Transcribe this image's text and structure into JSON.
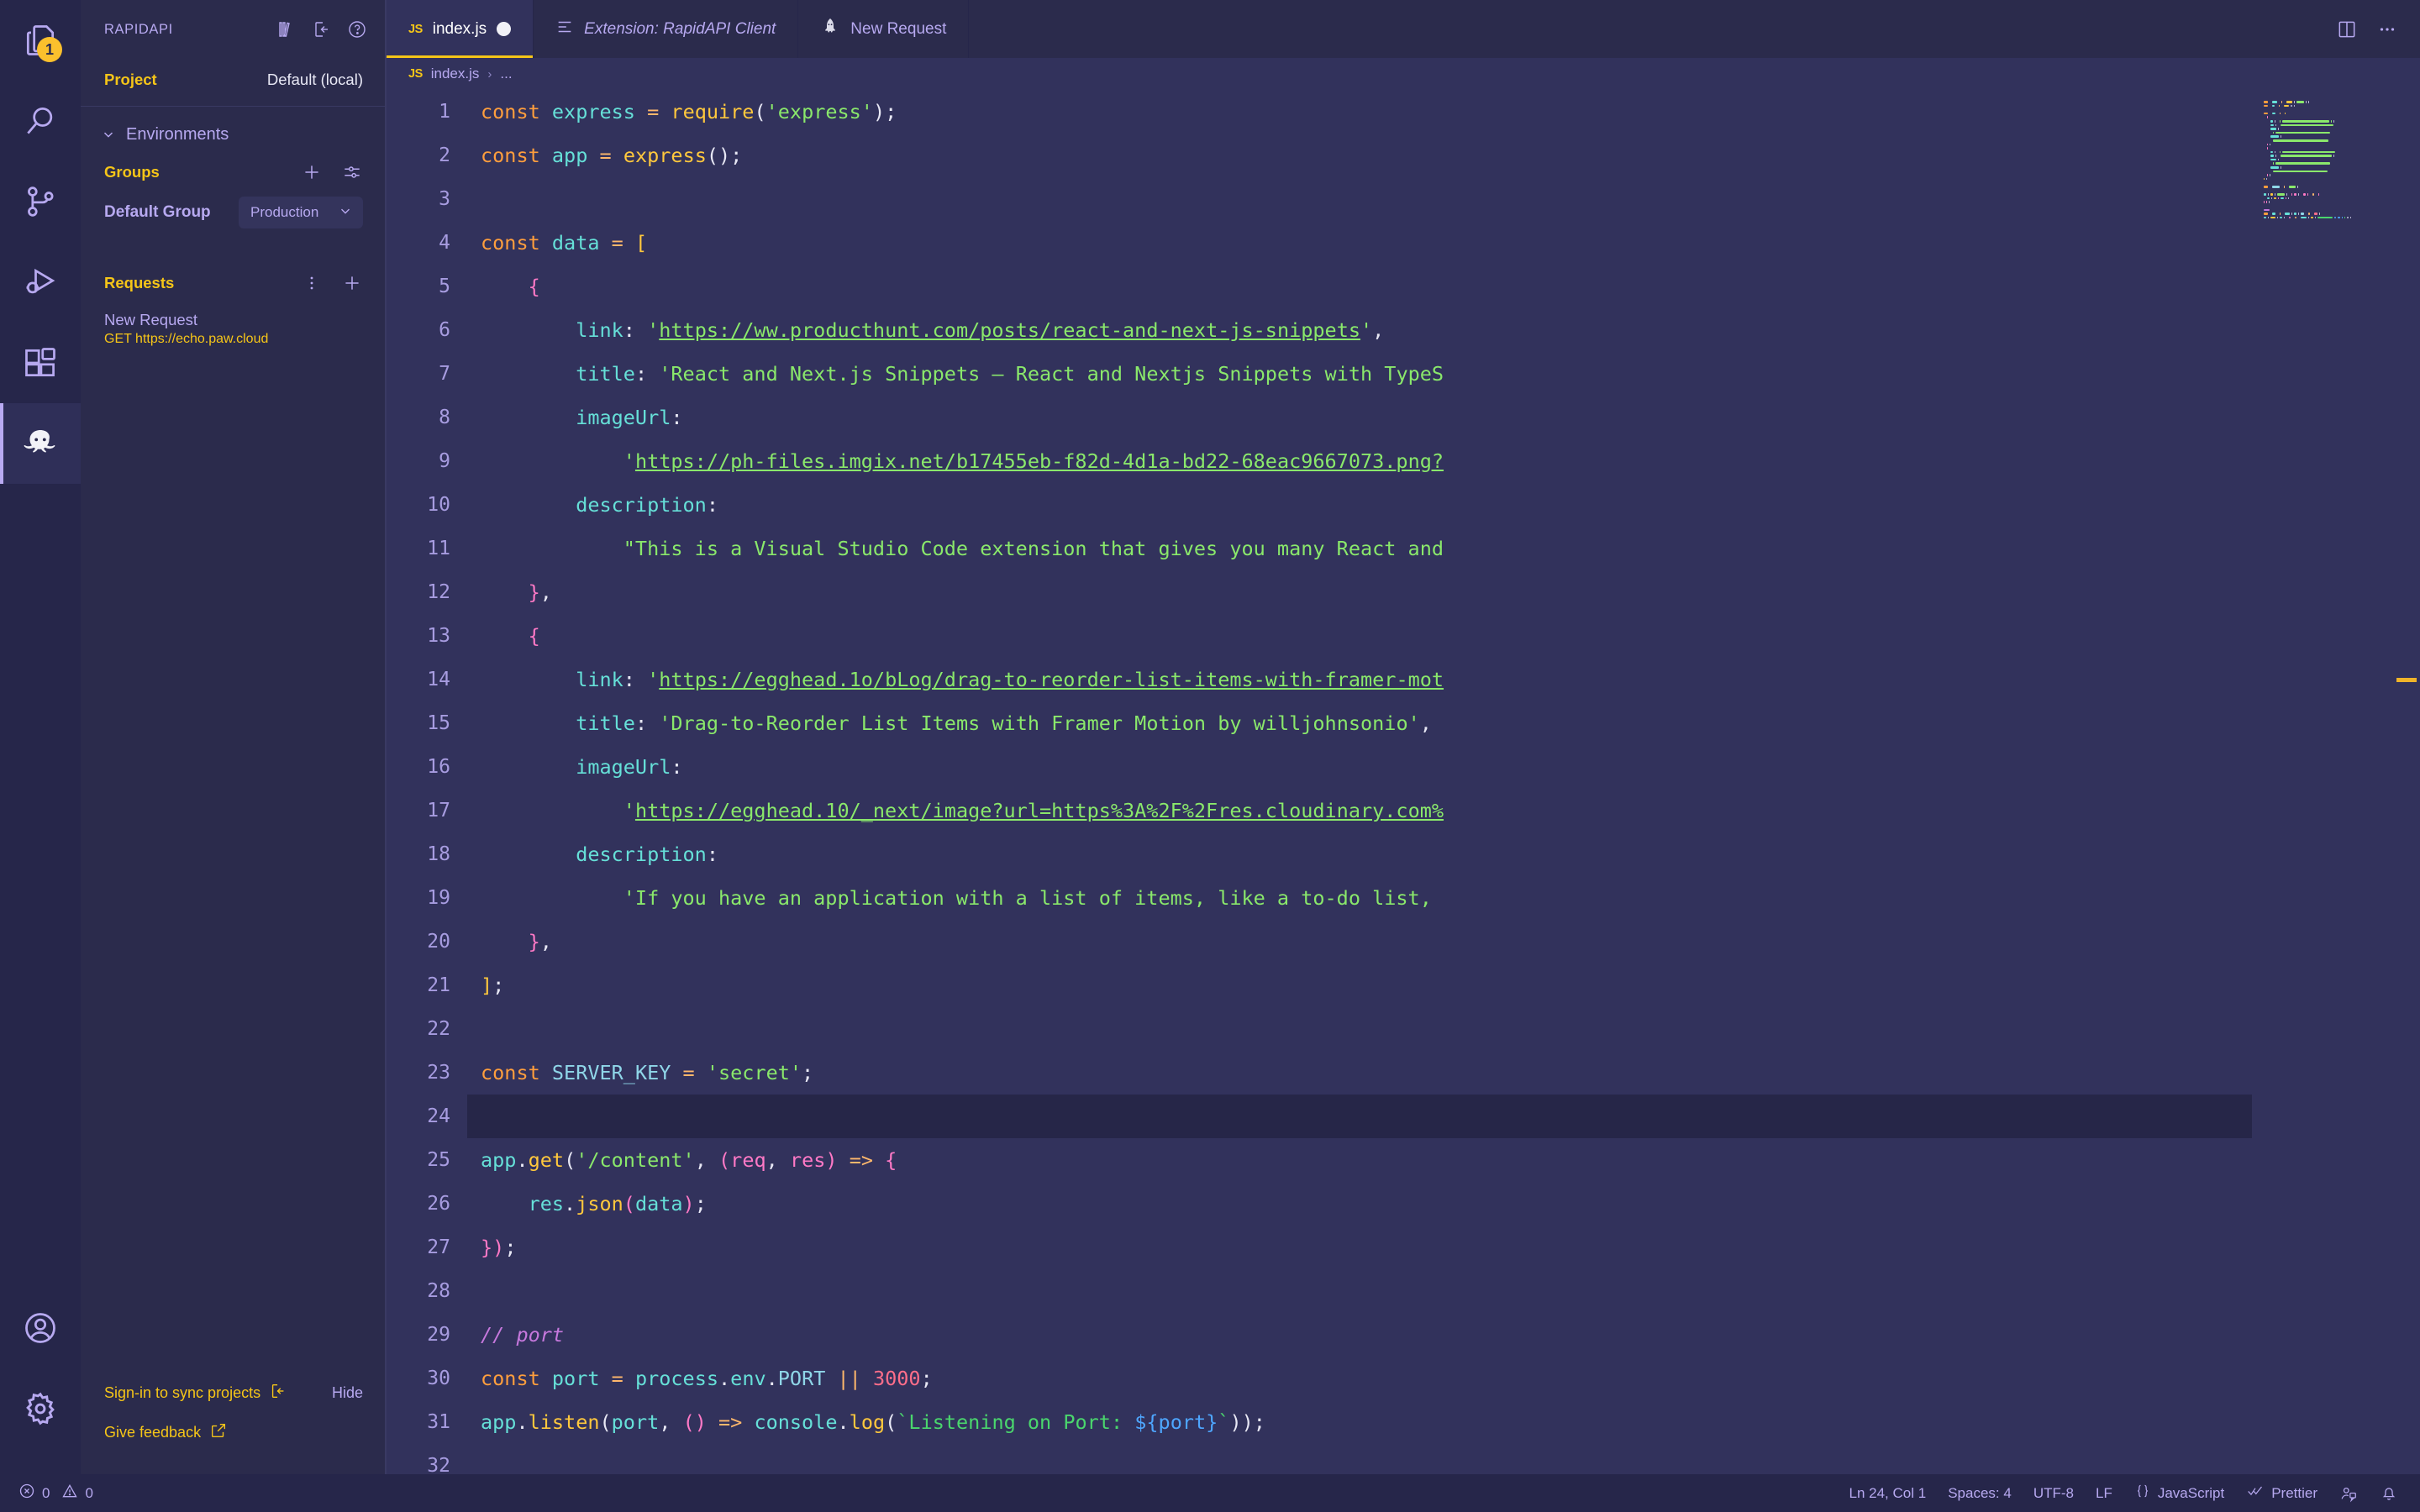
{
  "activity_bar": {
    "items": [
      {
        "name": "explorer",
        "icon": "files-icon",
        "badge": "1",
        "active": false
      },
      {
        "name": "search",
        "icon": "search-icon",
        "badge": "",
        "active": false
      },
      {
        "name": "source-control",
        "icon": "source-control-icon",
        "badge": "",
        "active": false
      },
      {
        "name": "run-debug",
        "icon": "run-debug-icon",
        "badge": "",
        "active": false
      },
      {
        "name": "extensions",
        "icon": "extensions-icon",
        "badge": "",
        "active": false
      },
      {
        "name": "rapidapi",
        "icon": "rapidapi-octopus-icon",
        "badge": "",
        "active": true
      }
    ],
    "bottom_items": [
      {
        "name": "accounts",
        "icon": "account-icon"
      },
      {
        "name": "manage",
        "icon": "gear-icon"
      }
    ]
  },
  "sidebar": {
    "title": "RAPIDAPI",
    "header_icons": [
      "library-icon",
      "open-panel-icon",
      "help-icon"
    ],
    "project": {
      "label": "Project",
      "value": "Default (local)"
    },
    "environments": {
      "label": "Environments",
      "collapse_icon": "chevron-down-icon"
    },
    "groups": {
      "label": "Groups",
      "add_icon": "plus-icon",
      "settings_icon": "sliders-icon",
      "rows": [
        {
          "name": "Default Group",
          "environment": "Production",
          "chevron": "chevron-down-icon"
        }
      ]
    },
    "requests": {
      "label": "Requests",
      "more_icon": "kebab-icon",
      "add_icon": "plus-icon",
      "items": [
        {
          "name": "New Request",
          "method_url": "GET https://echo.paw.cloud"
        }
      ]
    },
    "footer": {
      "signin_label": "Sign-in to sync projects",
      "signin_icon": "sign-in-icon",
      "hide_label": "Hide",
      "feedback_label": "Give feedback",
      "feedback_icon": "external-link-icon"
    }
  },
  "tabs": [
    {
      "label": "index.js",
      "icon": "js-file-icon",
      "active": true,
      "dirty": true,
      "italic": false
    },
    {
      "label": "Extension: RapidAPI Client",
      "icon": "extension-icon",
      "active": false,
      "dirty": false,
      "italic": true
    },
    {
      "label": "New Request",
      "icon": "rocket-icon",
      "active": false,
      "dirty": false,
      "italic": false
    }
  ],
  "tabbar_actions": [
    {
      "name": "split-editor",
      "icon": "split-editor-icon"
    },
    {
      "name": "more-actions",
      "icon": "ellipsis-icon"
    }
  ],
  "breadcrumb": {
    "file_icon": "js-file-icon",
    "file": "index.js",
    "separator": "›",
    "rest": "..."
  },
  "editor": {
    "first_line": 1,
    "cursor_line": 24,
    "lines": [
      {
        "n": 1,
        "tokens": [
          [
            "kw",
            "const"
          ],
          [
            "plain",
            " "
          ],
          [
            "var",
            "express"
          ],
          [
            "plain",
            " "
          ],
          [
            "op",
            "="
          ],
          [
            "plain",
            " "
          ],
          [
            "fn",
            "require"
          ],
          [
            "punc",
            "("
          ],
          [
            "str",
            "'express'"
          ],
          [
            "punc",
            ")"
          ],
          [
            "punc",
            ";"
          ]
        ]
      },
      {
        "n": 2,
        "tokens": [
          [
            "kw",
            "const"
          ],
          [
            "plain",
            " "
          ],
          [
            "var",
            "app"
          ],
          [
            "plain",
            " "
          ],
          [
            "op",
            "="
          ],
          [
            "plain",
            " "
          ],
          [
            "fn",
            "express"
          ],
          [
            "punc",
            "()"
          ],
          [
            "punc",
            ";"
          ]
        ]
      },
      {
        "n": 3,
        "tokens": []
      },
      {
        "n": 4,
        "tokens": [
          [
            "kw",
            "const"
          ],
          [
            "plain",
            " "
          ],
          [
            "var",
            "data"
          ],
          [
            "plain",
            " "
          ],
          [
            "op",
            "="
          ],
          [
            "plain",
            " "
          ],
          [
            "fn",
            "["
          ]
        ]
      },
      {
        "n": 5,
        "tokens": [
          [
            "plain",
            "    "
          ],
          [
            "brk",
            "{"
          ]
        ]
      },
      {
        "n": 6,
        "tokens": [
          [
            "plain",
            "        "
          ],
          [
            "prop",
            "link"
          ],
          [
            "punc",
            ":"
          ],
          [
            "plain",
            " "
          ],
          [
            "str",
            "'"
          ],
          [
            "link",
            "https://ww.producthunt.com/posts/react-and-next-js-snippets"
          ],
          [
            "str",
            "'"
          ],
          [
            "punc",
            ","
          ]
        ]
      },
      {
        "n": 7,
        "tokens": [
          [
            "plain",
            "        "
          ],
          [
            "prop",
            "title"
          ],
          [
            "punc",
            ":"
          ],
          [
            "plain",
            " "
          ],
          [
            "str",
            "'React and Next.js Snippets – React and Nextjs Snippets with TypeS"
          ]
        ]
      },
      {
        "n": 8,
        "tokens": [
          [
            "plain",
            "        "
          ],
          [
            "prop",
            "imageUrl"
          ],
          [
            "punc",
            ":"
          ]
        ]
      },
      {
        "n": 9,
        "tokens": [
          [
            "plain",
            "            "
          ],
          [
            "str",
            "'"
          ],
          [
            "link",
            "https://ph-files.imgix.net/b17455eb-f82d-4d1a-bd22-68eac9667073.png?"
          ]
        ]
      },
      {
        "n": 10,
        "tokens": [
          [
            "plain",
            "        "
          ],
          [
            "prop",
            "description"
          ],
          [
            "punc",
            ":"
          ]
        ]
      },
      {
        "n": 11,
        "tokens": [
          [
            "plain",
            "            "
          ],
          [
            "str",
            "\"This is a Visual Studio Code extension that gives you many React and"
          ]
        ]
      },
      {
        "n": 12,
        "tokens": [
          [
            "plain",
            "    "
          ],
          [
            "brk",
            "}"
          ],
          [
            "punc",
            ","
          ]
        ]
      },
      {
        "n": 13,
        "tokens": [
          [
            "plain",
            "    "
          ],
          [
            "brk",
            "{"
          ]
        ]
      },
      {
        "n": 14,
        "tokens": [
          [
            "plain",
            "        "
          ],
          [
            "prop",
            "link"
          ],
          [
            "punc",
            ":"
          ],
          [
            "plain",
            " "
          ],
          [
            "str",
            "'"
          ],
          [
            "link",
            "https://egghead.1o/bLog/drag-to-reorder-list-items-with-framer-mot"
          ]
        ]
      },
      {
        "n": 15,
        "tokens": [
          [
            "plain",
            "        "
          ],
          [
            "prop",
            "title"
          ],
          [
            "punc",
            ":"
          ],
          [
            "plain",
            " "
          ],
          [
            "str",
            "'Drag-to-Reorder List Items with Framer Motion by willjohnsonio'"
          ],
          [
            "punc",
            ","
          ]
        ]
      },
      {
        "n": 16,
        "tokens": [
          [
            "plain",
            "        "
          ],
          [
            "prop",
            "imageUrl"
          ],
          [
            "punc",
            ":"
          ]
        ]
      },
      {
        "n": 17,
        "tokens": [
          [
            "plain",
            "            "
          ],
          [
            "str",
            "'"
          ],
          [
            "link",
            "https://egghead.10/_next/image?url=https%3A%2F%2Fres.cloudinary.com%"
          ]
        ]
      },
      {
        "n": 18,
        "tokens": [
          [
            "plain",
            "        "
          ],
          [
            "prop",
            "description"
          ],
          [
            "punc",
            ":"
          ]
        ]
      },
      {
        "n": 19,
        "tokens": [
          [
            "plain",
            "            "
          ],
          [
            "str",
            "'If you have an application with a list of items, like a to-do list,"
          ]
        ]
      },
      {
        "n": 20,
        "tokens": [
          [
            "plain",
            "    "
          ],
          [
            "brk",
            "}"
          ],
          [
            "punc",
            ","
          ]
        ]
      },
      {
        "n": 21,
        "tokens": [
          [
            "fn",
            "]"
          ],
          [
            "punc",
            ";"
          ]
        ]
      },
      {
        "n": 22,
        "tokens": []
      },
      {
        "n": 23,
        "tokens": [
          [
            "kw",
            "const"
          ],
          [
            "plain",
            " "
          ],
          [
            "const",
            "SERVER_KEY"
          ],
          [
            "plain",
            " "
          ],
          [
            "op",
            "="
          ],
          [
            "plain",
            " "
          ],
          [
            "str",
            "'secret'"
          ],
          [
            "punc",
            ";"
          ]
        ]
      },
      {
        "n": 24,
        "tokens": []
      },
      {
        "n": 25,
        "tokens": [
          [
            "var",
            "app"
          ],
          [
            "punc",
            "."
          ],
          [
            "fn",
            "get"
          ],
          [
            "punc",
            "("
          ],
          [
            "str",
            "'/content'"
          ],
          [
            "punc",
            ","
          ],
          [
            "plain",
            " "
          ],
          [
            "brk",
            "("
          ],
          [
            "param",
            "req"
          ],
          [
            "punc",
            ","
          ],
          [
            "plain",
            " "
          ],
          [
            "param",
            "res"
          ],
          [
            "brk",
            ")"
          ],
          [
            "plain",
            " "
          ],
          [
            "op",
            "=>"
          ],
          [
            "plain",
            " "
          ],
          [
            "brk",
            "{"
          ]
        ]
      },
      {
        "n": 26,
        "tokens": [
          [
            "plain",
            "    "
          ],
          [
            "var",
            "res"
          ],
          [
            "punc",
            "."
          ],
          [
            "fn",
            "json"
          ],
          [
            "brk",
            "("
          ],
          [
            "var",
            "data"
          ],
          [
            "brk",
            ")"
          ],
          [
            "punc",
            ";"
          ]
        ]
      },
      {
        "n": 27,
        "tokens": [
          [
            "brk",
            "}"
          ],
          [
            "brk",
            ")"
          ],
          [
            "punc",
            ";"
          ]
        ]
      },
      {
        "n": 28,
        "tokens": []
      },
      {
        "n": 29,
        "tokens": [
          [
            "com",
            "// port"
          ]
        ]
      },
      {
        "n": 30,
        "tokens": [
          [
            "kw",
            "const"
          ],
          [
            "plain",
            " "
          ],
          [
            "var",
            "port"
          ],
          [
            "plain",
            " "
          ],
          [
            "op",
            "="
          ],
          [
            "plain",
            " "
          ],
          [
            "var",
            "process"
          ],
          [
            "punc",
            "."
          ],
          [
            "prop",
            "env"
          ],
          [
            "punc",
            "."
          ],
          [
            "const",
            "PORT"
          ],
          [
            "plain",
            " "
          ],
          [
            "op",
            "||"
          ],
          [
            "plain",
            " "
          ],
          [
            "num",
            "3000"
          ],
          [
            "punc",
            ";"
          ]
        ]
      },
      {
        "n": 31,
        "tokens": [
          [
            "var",
            "app"
          ],
          [
            "punc",
            "."
          ],
          [
            "fn",
            "listen"
          ],
          [
            "punc",
            "("
          ],
          [
            "var",
            "port"
          ],
          [
            "punc",
            ","
          ],
          [
            "plain",
            " "
          ],
          [
            "brk",
            "()"
          ],
          [
            "plain",
            " "
          ],
          [
            "op",
            "=>"
          ],
          [
            "plain",
            " "
          ],
          [
            "var",
            "console"
          ],
          [
            "punc",
            "."
          ],
          [
            "fn",
            "log"
          ],
          [
            "punc",
            "("
          ],
          [
            "tpl",
            "`Listening on Port: "
          ],
          [
            "tplx",
            "${"
          ],
          [
            "tplx",
            "port"
          ],
          [
            "tplx",
            "}"
          ],
          [
            "tpl",
            "`"
          ],
          [
            "punc",
            "))"
          ],
          [
            "punc",
            ";"
          ]
        ]
      },
      {
        "n": 32,
        "tokens": []
      }
    ]
  },
  "status_bar": {
    "left": [
      {
        "name": "problems",
        "icon": "error-icon",
        "errors": "0",
        "warn_icon": "warning-icon",
        "warnings": "0"
      }
    ],
    "right": [
      {
        "name": "cursor-position",
        "label": "Ln 24, Col 1"
      },
      {
        "name": "indentation",
        "label": "Spaces: 4"
      },
      {
        "name": "encoding",
        "label": "UTF-8"
      },
      {
        "name": "eol",
        "label": "LF"
      },
      {
        "name": "language-mode",
        "label": "JavaScript",
        "icon": "braces-icon"
      },
      {
        "name": "formatter",
        "label": "Prettier",
        "icon": "checks-icon"
      },
      {
        "name": "remote-feedback",
        "label": "",
        "icon": "feedback-icon"
      },
      {
        "name": "notifications",
        "label": "",
        "icon": "bell-icon"
      }
    ]
  },
  "colors": {
    "accent_yellow": "#f5c518",
    "accent_purple": "#b7a9f0",
    "editor_bg": "#32325c",
    "chrome_bg": "#2b2b4c",
    "activitybar_bg": "#26264a",
    "string_green": "#8ae86b"
  }
}
